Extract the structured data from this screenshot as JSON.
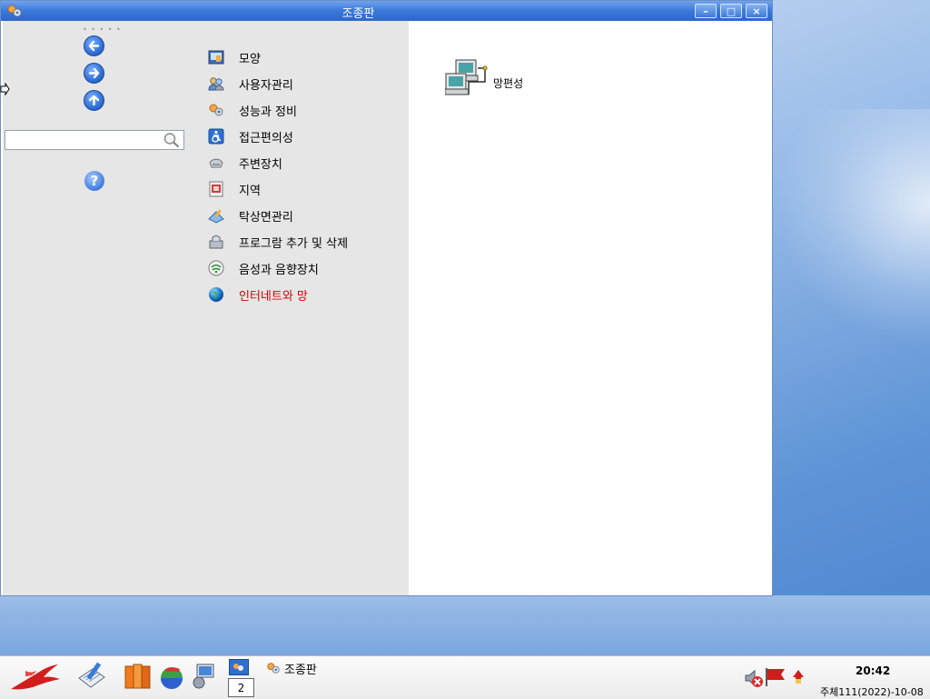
{
  "window": {
    "title": "조종판",
    "controls": {
      "minimize": "–",
      "maximize": "□",
      "close": "×"
    }
  },
  "sidebar": {
    "nav": [
      {
        "name": "back",
        "icon": "arrow-left-icon"
      },
      {
        "name": "forward",
        "icon": "arrow-right-icon"
      },
      {
        "name": "up",
        "icon": "arrow-up-icon"
      }
    ],
    "search": {
      "value": "",
      "placeholder": ""
    },
    "help": {
      "icon": "help-icon",
      "text": "?"
    }
  },
  "categories": [
    {
      "label": "모양",
      "icon": "appearance-icon"
    },
    {
      "label": "사용자관리",
      "icon": "users-icon"
    },
    {
      "label": "성능과 정비",
      "icon": "performance-icon"
    },
    {
      "label": "접근편의성",
      "icon": "accessibility-icon"
    },
    {
      "label": "주변장치",
      "icon": "peripherals-icon"
    },
    {
      "label": "지역",
      "icon": "region-icon"
    },
    {
      "label": "탁상면관리",
      "icon": "desktop-icon"
    },
    {
      "label": "프로그람 추가 및 삭제",
      "icon": "programs-icon"
    },
    {
      "label": "음성과 음향장치",
      "icon": "sound-icon"
    },
    {
      "label": "인터네트와 망",
      "icon": "internet-icon",
      "active": true
    }
  ],
  "content": {
    "items": [
      {
        "label": "망편성",
        "icon": "network-computers-icon"
      }
    ]
  },
  "taskbar": {
    "pager": "2",
    "task": {
      "label": "조종판",
      "icon": "control-panel-icon"
    },
    "clock": "20:42",
    "date": "주체111(2022)-10-08"
  },
  "colors": {
    "active_category": "#d40000",
    "titlebar": "#3a78dc",
    "sidebar_bg": "#e6e6e6"
  }
}
